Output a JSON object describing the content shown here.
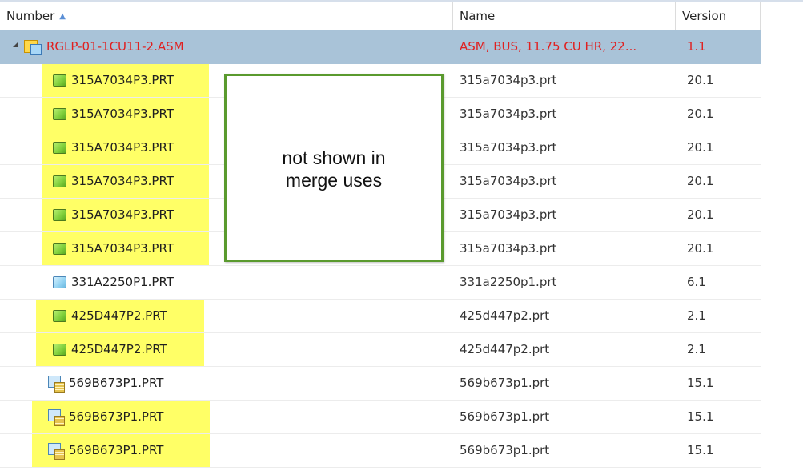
{
  "columns": {
    "number": "Number",
    "name": "Name",
    "version": "Version"
  },
  "root": {
    "number": "RGLP-01-1CU11-2.ASM",
    "name": "ASM, BUS, 11.75 CU HR, 22...",
    "version": "1.1",
    "icon": "assembly-icon"
  },
  "rows": [
    {
      "number": "315A7034P3.PRT",
      "name": "315a7034p3.prt",
      "version": "20.1",
      "icon": "green-part-icon",
      "highlighted": true
    },
    {
      "number": "315A7034P3.PRT",
      "name": "315a7034p3.prt",
      "version": "20.1",
      "icon": "green-part-icon",
      "highlighted": true
    },
    {
      "number": "315A7034P3.PRT",
      "name": "315a7034p3.prt",
      "version": "20.1",
      "icon": "green-part-icon",
      "highlighted": true
    },
    {
      "number": "315A7034P3.PRT",
      "name": "315a7034p3.prt",
      "version": "20.1",
      "icon": "green-part-icon",
      "highlighted": true
    },
    {
      "number": "315A7034P3.PRT",
      "name": "315a7034p3.prt",
      "version": "20.1",
      "icon": "green-part-icon",
      "highlighted": true
    },
    {
      "number": "315A7034P3.PRT",
      "name": "315a7034p3.prt",
      "version": "20.1",
      "icon": "green-part-icon",
      "highlighted": true
    },
    {
      "number": "331A2250P1.PRT",
      "name": "331a2250p1.prt",
      "version": "6.1",
      "icon": "blue-part-icon",
      "highlighted": false
    },
    {
      "number": "425D447P2.PRT",
      "name": "425d447p2.prt",
      "version": "2.1",
      "icon": "green-part-icon",
      "highlighted": true
    },
    {
      "number": "425D447P2.PRT",
      "name": "425d447p2.prt",
      "version": "2.1",
      "icon": "green-part-icon",
      "highlighted": true
    },
    {
      "number": "569B673P1.PRT",
      "name": "569b673p1.prt",
      "version": "15.1",
      "icon": "family-table-part-icon",
      "highlighted": false
    },
    {
      "number": "569B673P1.PRT",
      "name": "569b673p1.prt",
      "version": "15.1",
      "icon": "family-table-part-icon",
      "highlighted": true
    },
    {
      "number": "569B673P1.PRT",
      "name": "569b673p1.prt",
      "version": "15.1",
      "icon": "family-table-part-icon",
      "highlighted": true
    }
  ],
  "callout": {
    "line1": "not shown in",
    "line2": "merge uses"
  },
  "colors": {
    "highlight": "#ffff66",
    "selected_row": "#a9c3d8",
    "root_text": "#e02020",
    "callout_border": "#5a9a2e"
  }
}
